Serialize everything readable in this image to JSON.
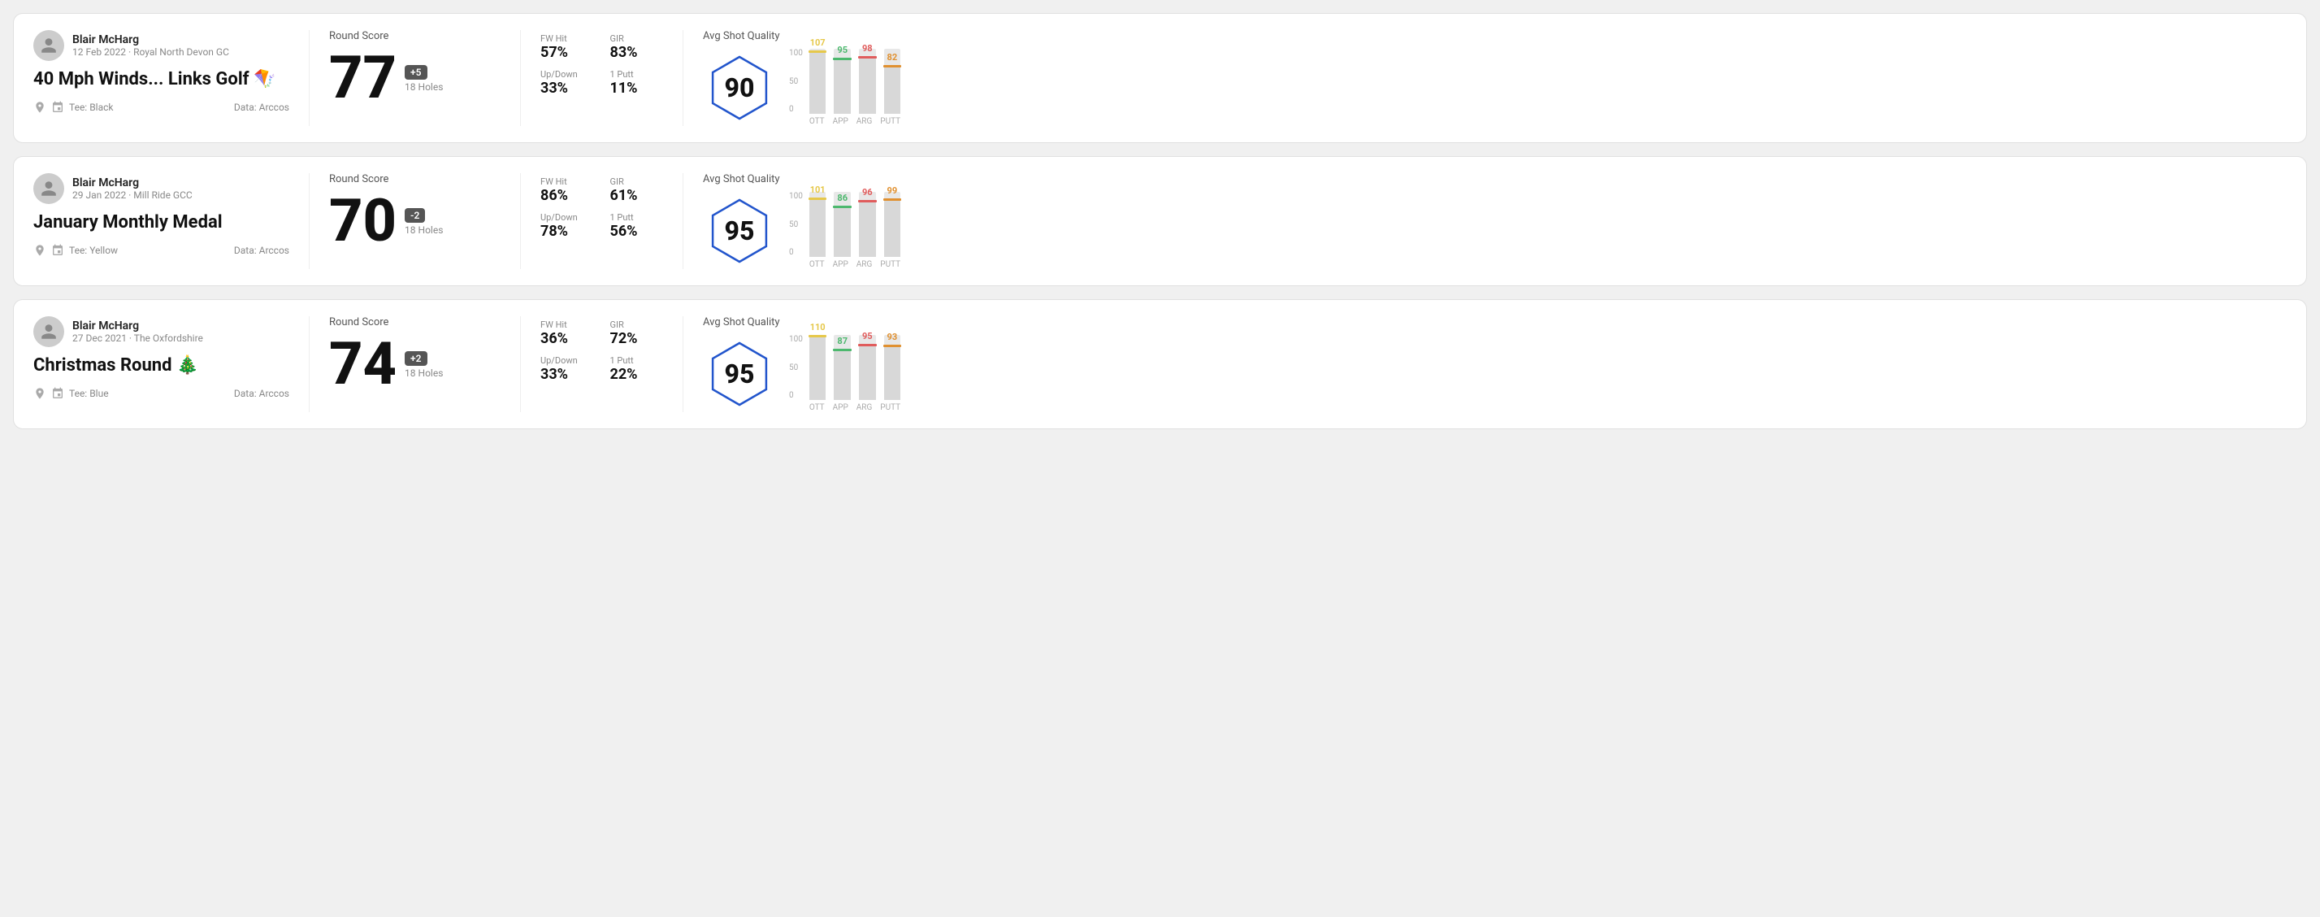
{
  "rounds": [
    {
      "id": "round1",
      "user": {
        "name": "Blair McHarg",
        "meta": "12 Feb 2022 · Royal North Devon GC"
      },
      "title": "40 Mph Winds... Links Golf",
      "title_emoji": "🪁",
      "tee": "Black",
      "data_source": "Data: Arccos",
      "round_score_label": "Round Score",
      "score": "77",
      "score_diff": "+5",
      "holes": "18 Holes",
      "fw_hit_label": "FW Hit",
      "fw_hit": "57%",
      "gir_label": "GIR",
      "gir": "83%",
      "updown_label": "Up/Down",
      "updown": "33%",
      "oneputt_label": "1 Putt",
      "oneputt": "11%",
      "avg_shot_quality_label": "Avg Shot Quality",
      "quality_score": "90",
      "chart": {
        "bars": [
          {
            "label": "OTT",
            "value": 107,
            "color": "#e6c84a",
            "height_pct": 72
          },
          {
            "label": "APP",
            "value": 95,
            "color": "#4db86e",
            "height_pct": 60
          },
          {
            "label": "ARG",
            "value": 98,
            "color": "#e05c5c",
            "height_pct": 63
          },
          {
            "label": "PUTT",
            "value": 82,
            "color": "#e09030",
            "height_pct": 50
          }
        ]
      }
    },
    {
      "id": "round2",
      "user": {
        "name": "Blair McHarg",
        "meta": "29 Jan 2022 · Mill Ride GCC"
      },
      "title": "January Monthly Medal",
      "title_emoji": "",
      "tee": "Yellow",
      "data_source": "Data: Arccos",
      "round_score_label": "Round Score",
      "score": "70",
      "score_diff": "-2",
      "holes": "18 Holes",
      "fw_hit_label": "FW Hit",
      "fw_hit": "86%",
      "gir_label": "GIR",
      "gir": "61%",
      "updown_label": "Up/Down",
      "updown": "78%",
      "oneputt_label": "1 Putt",
      "oneputt": "56%",
      "avg_shot_quality_label": "Avg Shot Quality",
      "quality_score": "95",
      "chart": {
        "bars": [
          {
            "label": "OTT",
            "value": 101,
            "color": "#e6c84a",
            "height_pct": 67
          },
          {
            "label": "APP",
            "value": 86,
            "color": "#4db86e",
            "height_pct": 53
          },
          {
            "label": "ARG",
            "value": 96,
            "color": "#e05c5c",
            "height_pct": 62
          },
          {
            "label": "PUTT",
            "value": 99,
            "color": "#e09030",
            "height_pct": 65
          }
        ]
      }
    },
    {
      "id": "round3",
      "user": {
        "name": "Blair McHarg",
        "meta": "27 Dec 2021 · The Oxfordshire"
      },
      "title": "Christmas Round",
      "title_emoji": "🎄",
      "tee": "Blue",
      "data_source": "Data: Arccos",
      "round_score_label": "Round Score",
      "score": "74",
      "score_diff": "+2",
      "holes": "18 Holes",
      "fw_hit_label": "FW Hit",
      "fw_hit": "36%",
      "gir_label": "GIR",
      "gir": "72%",
      "updown_label": "Up/Down",
      "updown": "33%",
      "oneputt_label": "1 Putt",
      "oneputt": "22%",
      "avg_shot_quality_label": "Avg Shot Quality",
      "quality_score": "95",
      "chart": {
        "bars": [
          {
            "label": "OTT",
            "value": 110,
            "color": "#e6c84a",
            "height_pct": 75
          },
          {
            "label": "APP",
            "value": 87,
            "color": "#4db86e",
            "height_pct": 54
          },
          {
            "label": "ARG",
            "value": 95,
            "color": "#e05c5c",
            "height_pct": 62
          },
          {
            "label": "PUTT",
            "value": 93,
            "color": "#e09030",
            "height_pct": 61
          }
        ]
      }
    }
  ]
}
